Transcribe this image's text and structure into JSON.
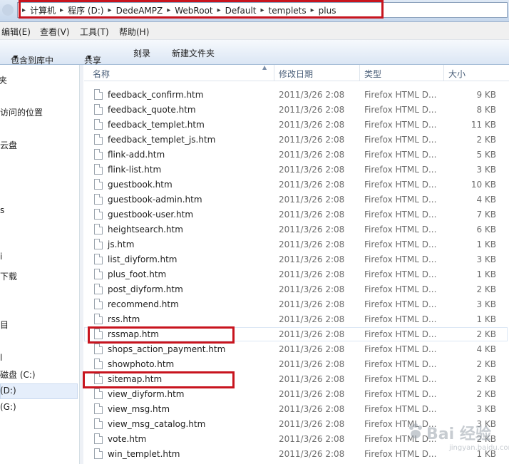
{
  "address": {
    "crumbs": [
      "计算机",
      "程序 (D:)",
      "DedeAMPZ",
      "WebRoot",
      "Default",
      "templets",
      "plus"
    ]
  },
  "menu": {
    "items": [
      "编辑(E)",
      "查看(V)",
      "工具(T)",
      "帮助(H)"
    ]
  },
  "toolbar": {
    "library_label": "包含到库中",
    "share_label": "共享",
    "burn_label": "刻录",
    "new_folder_label": "新建文件夹"
  },
  "nav": {
    "items": [
      "夹",
      "",
      "访问的位置",
      "云盘",
      "s",
      "i",
      "下载",
      "",
      "目",
      "l",
      "磁盘 (C:)",
      "(D:)",
      "(G:)"
    ]
  },
  "columns": {
    "name": "名称",
    "date": "修改日期",
    "type": "类型",
    "size": "大小"
  },
  "files": [
    {
      "name": "feedback_confirm.htm",
      "date": "2011/3/26 2:08",
      "type": "Firefox HTML D...",
      "size": "9 KB"
    },
    {
      "name": "feedback_quote.htm",
      "date": "2011/3/26 2:08",
      "type": "Firefox HTML D...",
      "size": "8 KB"
    },
    {
      "name": "feedback_templet.htm",
      "date": "2011/3/26 2:08",
      "type": "Firefox HTML D...",
      "size": "11 KB"
    },
    {
      "name": "feedback_templet_js.htm",
      "date": "2011/3/26 2:08",
      "type": "Firefox HTML D...",
      "size": "2 KB"
    },
    {
      "name": "flink-add.htm",
      "date": "2011/3/26 2:08",
      "type": "Firefox HTML D...",
      "size": "5 KB"
    },
    {
      "name": "flink-list.htm",
      "date": "2011/3/26 2:08",
      "type": "Firefox HTML D...",
      "size": "3 KB"
    },
    {
      "name": "guestbook.htm",
      "date": "2011/3/26 2:08",
      "type": "Firefox HTML D...",
      "size": "10 KB"
    },
    {
      "name": "guestbook-admin.htm",
      "date": "2011/3/26 2:08",
      "type": "Firefox HTML D...",
      "size": "4 KB"
    },
    {
      "name": "guestbook-user.htm",
      "date": "2011/3/26 2:08",
      "type": "Firefox HTML D...",
      "size": "7 KB"
    },
    {
      "name": "heightsearch.htm",
      "date": "2011/3/26 2:08",
      "type": "Firefox HTML D...",
      "size": "6 KB"
    },
    {
      "name": "js.htm",
      "date": "2011/3/26 2:08",
      "type": "Firefox HTML D...",
      "size": "1 KB"
    },
    {
      "name": "list_diyform.htm",
      "date": "2011/3/26 2:08",
      "type": "Firefox HTML D...",
      "size": "3 KB"
    },
    {
      "name": "plus_foot.htm",
      "date": "2011/3/26 2:08",
      "type": "Firefox HTML D...",
      "size": "1 KB"
    },
    {
      "name": "post_diyform.htm",
      "date": "2011/3/26 2:08",
      "type": "Firefox HTML D...",
      "size": "2 KB"
    },
    {
      "name": "recommend.htm",
      "date": "2011/3/26 2:08",
      "type": "Firefox HTML D...",
      "size": "3 KB"
    },
    {
      "name": "rss.htm",
      "date": "2011/3/26 2:08",
      "type": "Firefox HTML D...",
      "size": "1 KB"
    },
    {
      "name": "rssmap.htm",
      "date": "2011/3/26 2:08",
      "type": "Firefox HTML D...",
      "size": "2 KB"
    },
    {
      "name": "shops_action_payment.htm",
      "date": "2011/3/26 2:08",
      "type": "Firefox HTML D...",
      "size": "4 KB"
    },
    {
      "name": "showphoto.htm",
      "date": "2011/3/26 2:08",
      "type": "Firefox HTML D...",
      "size": "2 KB"
    },
    {
      "name": "sitemap.htm",
      "date": "2011/3/26 2:08",
      "type": "Firefox HTML D...",
      "size": "2 KB"
    },
    {
      "name": "view_diyform.htm",
      "date": "2011/3/26 2:08",
      "type": "Firefox HTML D...",
      "size": "2 KB"
    },
    {
      "name": "view_msg.htm",
      "date": "2011/3/26 2:08",
      "type": "Firefox HTML D...",
      "size": "3 KB"
    },
    {
      "name": "view_msg_catalog.htm",
      "date": "2011/3/26 2:08",
      "type": "Firefox HTML D...",
      "size": "3 KB"
    },
    {
      "name": "vote.htm",
      "date": "2011/3/26 2:08",
      "type": "Firefox HTML D...",
      "size": "2 KB"
    },
    {
      "name": "win_templet.htm",
      "date": "2011/3/26 2:08",
      "type": "Firefox HTML D...",
      "size": "1 KB"
    }
  ],
  "highlighted_files": [
    "rssmap.htm",
    "sitemap.htm"
  ],
  "watermark": {
    "text": "Bai 经验",
    "sub": "jingyan.baidu.com"
  },
  "colors": {
    "highlight_box": "#c8141e",
    "header_text": "#4c607a"
  },
  "icons": {
    "file": "document-icon",
    "back": "back-arrow-icon",
    "dropdown": "chevron-down-icon"
  }
}
